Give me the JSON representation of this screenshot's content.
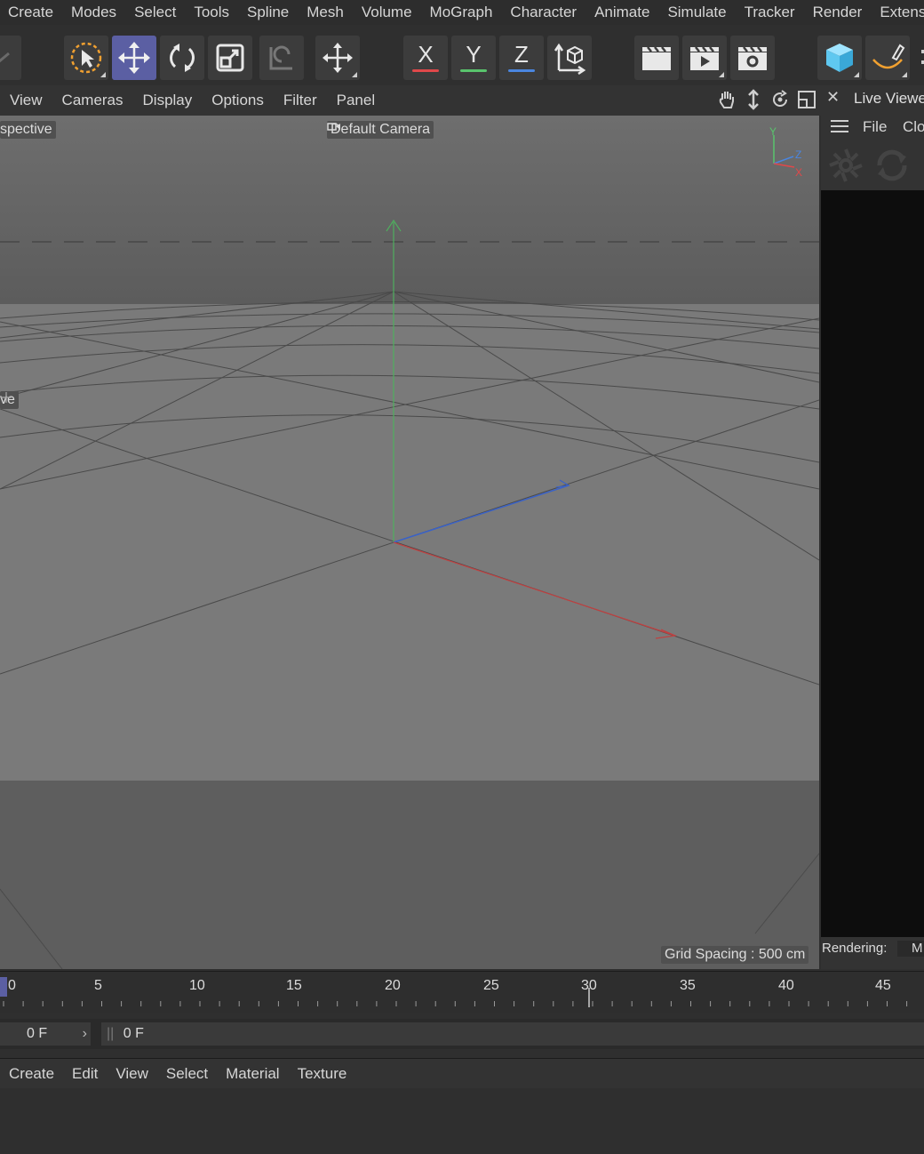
{
  "menubar": {
    "items": [
      "Create",
      "Modes",
      "Select",
      "Tools",
      "Spline",
      "Mesh",
      "Volume",
      "MoGraph",
      "Character",
      "Animate",
      "Simulate",
      "Tracker",
      "Render",
      "Extensions"
    ]
  },
  "toolbar": {
    "axis_x": "X",
    "axis_y": "Y",
    "axis_z": "Z",
    "colors": {
      "x": "#e0484a",
      "y": "#59c46d",
      "z": "#4a86e0",
      "active": "#5b5fa3",
      "cube": "#5fc8f0"
    }
  },
  "viewport": {
    "menu": [
      "View",
      "Cameras",
      "Display",
      "Options",
      "Filter",
      "Panel"
    ],
    "projection_label": "spective",
    "camera_label": "Default Camera",
    "move_label": "ve",
    "grid_spacing": "Grid Spacing : 500 cm",
    "axis_gizmo": {
      "y": "Y",
      "z": "Z",
      "x": "X"
    }
  },
  "live_viewer": {
    "title": "Live Viewer",
    "menu": [
      "File",
      "Clo"
    ],
    "status_label": "Rendering:",
    "status_value": "M"
  },
  "timeline": {
    "ticks": [
      "0",
      "5",
      "10",
      "15",
      "20",
      "25",
      "30",
      "35",
      "40",
      "45"
    ],
    "current_frame": "0 F",
    "end_frame": "0 F"
  },
  "material_manager": {
    "menu": [
      "Create",
      "Edit",
      "View",
      "Select",
      "Material",
      "Texture"
    ]
  }
}
